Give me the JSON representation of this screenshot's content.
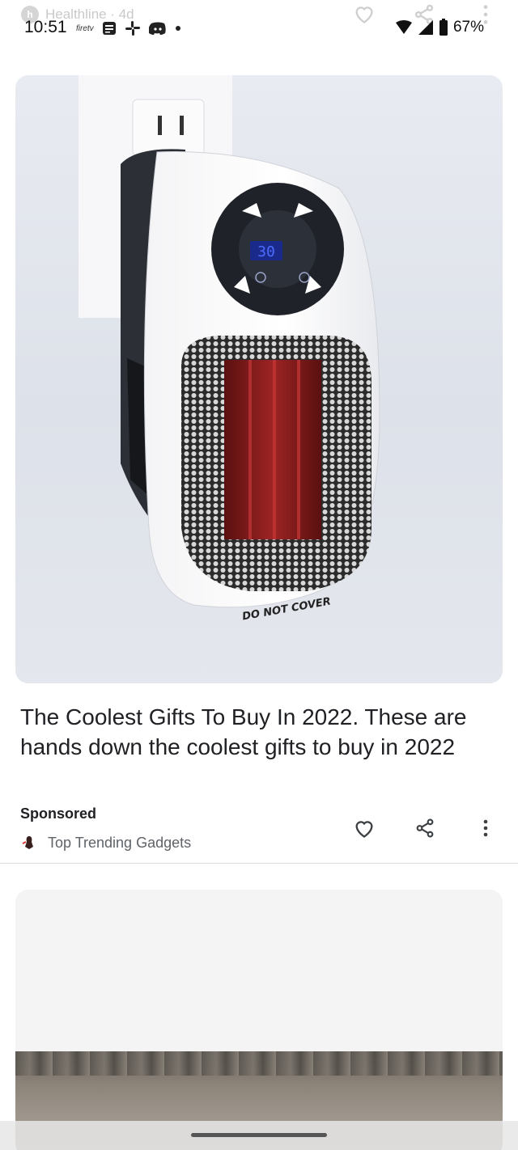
{
  "status_bar": {
    "time": "10:51",
    "notification_icons": [
      "firetv-icon",
      "news-icon",
      "slack-icon",
      "discord-icon",
      "dot-icon"
    ],
    "firetv_label": "firetv",
    "battery": "67%"
  },
  "behind_header": {
    "source": "Healthline · 4d"
  },
  "card1": {
    "title": "The Coolest Gifts To Buy In 2022. These are hands down the coolest gifts to buy in 2022",
    "sponsored_label": "Sponsored",
    "source_name": "Top Trending Gadgets",
    "image": {
      "display_value": "30",
      "label_text": "DO NOT COVER"
    }
  },
  "colors": {
    "text_primary": "#202124",
    "text_secondary": "#5f6368",
    "divider": "#dadce0",
    "display_blue": "#3a5cff"
  }
}
